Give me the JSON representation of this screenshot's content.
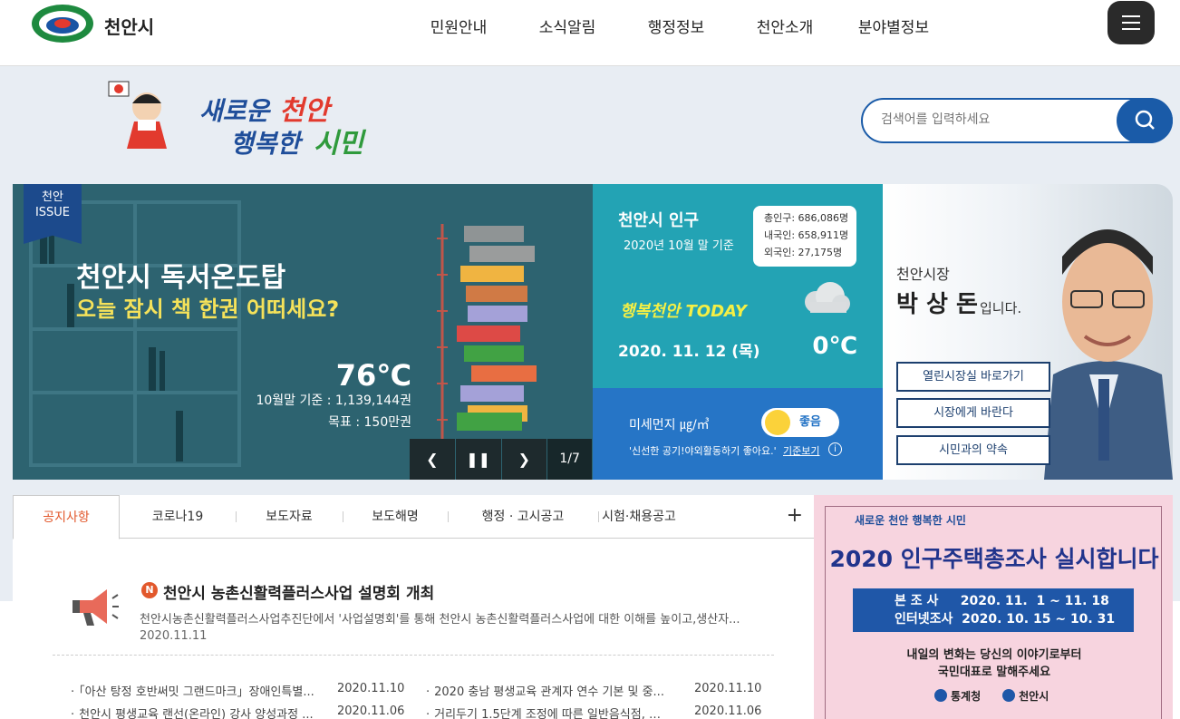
{
  "header": {
    "logo_text": "천안시",
    "nav": [
      "민원안내",
      "소식알림",
      "행정정보",
      "천안소개",
      "분야별정보"
    ]
  },
  "search": {
    "placeholder": "검색어를 입력하세요"
  },
  "issue": {
    "badge_line1": "천안",
    "badge_line2": "ISSUE",
    "title": "천안시 독서온도탑",
    "subtitle": "오늘 잠시 책 한권 어떠세요?",
    "temperature": "76℃",
    "base": "10월말 기준 : 1,139,144권",
    "goal": "목표 : 150만권",
    "page": "1/7"
  },
  "population": {
    "title": "천안시 인구",
    "basis": "2020년 10월 말 기준",
    "total": "총인구: 686,086명",
    "domestic": "내국인: 658,911명",
    "foreign": "외국인: 27,175명",
    "today": "행복천안 TODAY",
    "date": "2020. 11. 12 (목)",
    "temp": "0℃"
  },
  "dust": {
    "label": "미세먼지  ㎍/㎥",
    "status": "좋음",
    "note": "'신선한 공기!야외활동하기 좋아요.'",
    "more": "기준보기",
    "info": "i"
  },
  "mayor": {
    "role": "천안시장",
    "name": "박 상 돈",
    "suffix": "입니다.",
    "links": [
      "열린시장실 바로가기",
      "시장에게 바란다",
      "시민과의 약속"
    ]
  },
  "board": {
    "tabs": [
      "공지사항",
      "코로나19",
      "보도자료",
      "보도해명",
      "행정 · 고시공고",
      "시험·채용공고"
    ],
    "plus": "+",
    "new_mark": "N",
    "headline": {
      "title": "천안시 농촌신활력플러스사업 설명회 개최",
      "desc": "천안시농촌신활력플러스사업추진단에서 '사업설명회'를 통해 천안시 농촌신활력플러스사업에 대한 이해를 높이고,생산자...",
      "date": "2020.11.11"
    },
    "items": [
      {
        "title": "「아산 탕정 호반써밋 그랜드마크」장애인특별...",
        "date": "2020.11.10"
      },
      {
        "title": "2020 충남 평생교육 관계자 연수 기본 및 중...",
        "date": "2020.11.10"
      },
      {
        "title": "천안시 평생교육 랜선(온라인) 강사 양성과정 ...",
        "date": "2020.11.06"
      },
      {
        "title": "거리두기 1.5단계 조정에 따른 일반음식점, 휴...",
        "date": "2020.11.06"
      }
    ]
  },
  "banner": {
    "top": "새로운 천안 행복한 시민",
    "title": "2020 인구주택총조사 실시합니다",
    "line1": "본 조 사     2020. 11.  1 ~ 11. 18",
    "line2": "인터넷조사  2020. 10. 15 ~ 10. 31",
    "msg1": "내일의 변화는 당신의 이야기로부터",
    "msg2": "국민대표로 말해주세요",
    "logo1": "통계청",
    "logo2": "천안시"
  }
}
